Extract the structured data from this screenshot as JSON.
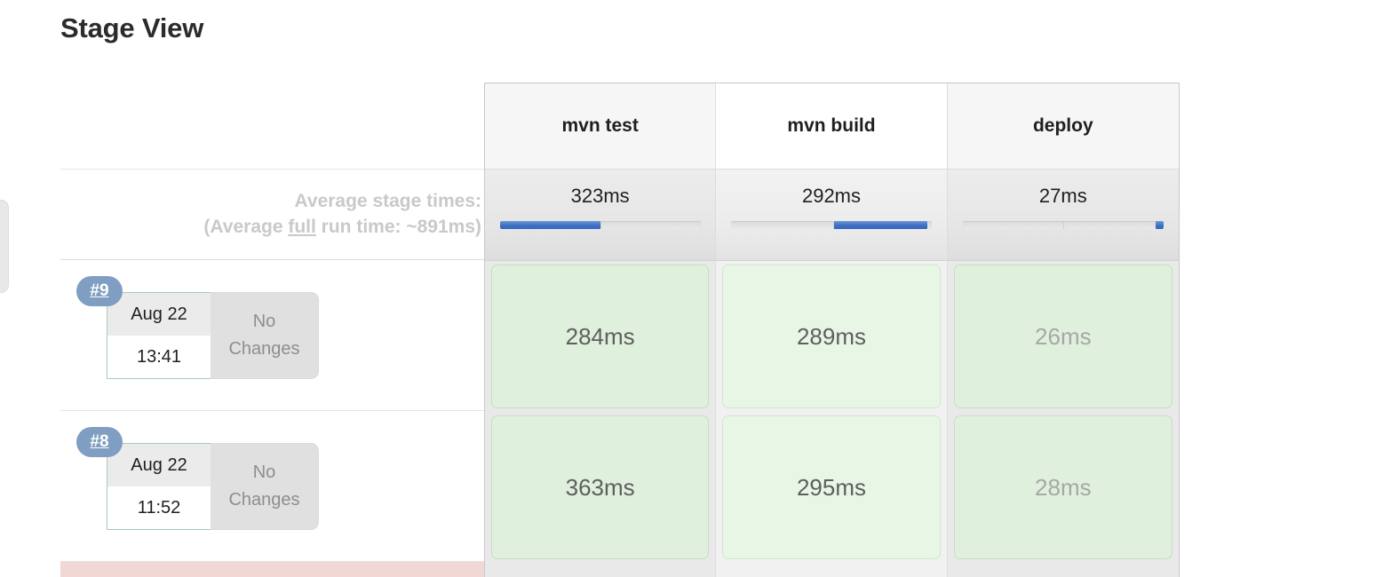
{
  "page": {
    "title": "Stage View"
  },
  "table": {
    "stages": [
      {
        "name": "mvn test"
      },
      {
        "name": "mvn build"
      },
      {
        "name": "deploy"
      }
    ],
    "averages": {
      "label_line1": "Average stage times:",
      "label_line2_pre": "(Average ",
      "label_line2_underlined": "full",
      "label_line2_post": " run time: ~891ms)",
      "full_run_time": "~891ms",
      "cells": [
        {
          "time": "323ms",
          "bar_start_pct": 0,
          "bar_end_pct": 50
        },
        {
          "time": "292ms",
          "bar_start_pct": 51,
          "bar_end_pct": 98
        },
        {
          "time": "27ms",
          "bar_start_pct": 95,
          "bar_end_pct": 100
        }
      ]
    },
    "builds": [
      {
        "number": "#9",
        "date": "Aug 22",
        "time": "13:41",
        "changes": "No Changes",
        "status": "success",
        "cells": [
          {
            "duration": "284ms",
            "status": "success",
            "muted": false
          },
          {
            "duration": "289ms",
            "status": "success",
            "muted": false
          },
          {
            "duration": "26ms",
            "status": "success",
            "muted": true
          }
        ]
      },
      {
        "number": "#8",
        "date": "Aug 22",
        "time": "11:52",
        "changes": "No Changes",
        "status": "success",
        "cells": [
          {
            "duration": "363ms",
            "status": "success",
            "muted": false
          },
          {
            "duration": "295ms",
            "status": "success",
            "muted": false
          },
          {
            "duration": "28ms",
            "status": "success",
            "muted": true
          }
        ]
      },
      {
        "number": "",
        "date": "",
        "time": "",
        "changes": "",
        "status": "failed",
        "cells": [
          {
            "duration": "",
            "status": "pending",
            "muted": false
          },
          {
            "duration": "",
            "status": "pending",
            "muted": false
          },
          {
            "duration": "",
            "status": "pending",
            "muted": false
          }
        ]
      }
    ]
  },
  "colors": {
    "accent_blue": "#3f6fc4",
    "badge_blue": "#7f9ec2",
    "success_green": "#dff0dc",
    "success_border": "#a6cdb3",
    "failed_red": "#f2d7d7",
    "muted_gray": "#a8a8a8"
  }
}
